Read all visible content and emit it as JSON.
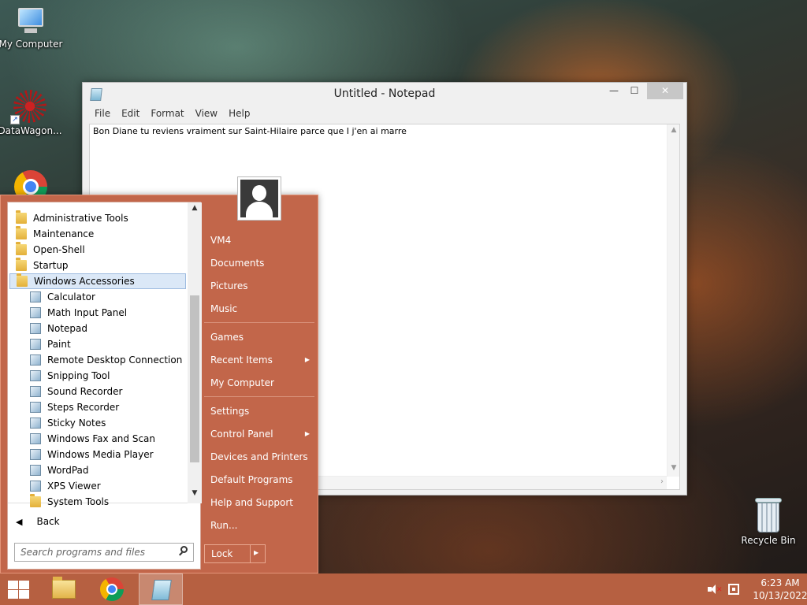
{
  "desktop": {
    "icons": [
      {
        "label": "My Computer"
      },
      {
        "label": "DataWagon..."
      },
      {
        "label": ""
      },
      {
        "label": "Recycle Bin"
      }
    ]
  },
  "notepad": {
    "title": "Untitled - Notepad",
    "controls": {
      "minimize": "—",
      "maximize": "☐",
      "close": "✕"
    },
    "menu": [
      "File",
      "Edit",
      "Format",
      "View",
      "Help"
    ],
    "content": "Bon Diane tu reviens vraiment sur Saint-Hilaire parce que I j'en ai marre"
  },
  "start_menu": {
    "programs": [
      {
        "label": "Administrative Tools",
        "icon": "folder-icon"
      },
      {
        "label": "Maintenance",
        "icon": "folder-icon"
      },
      {
        "label": "Open-Shell",
        "icon": "folder-icon"
      },
      {
        "label": "Startup",
        "icon": "folder-icon"
      },
      {
        "label": "Windows Accessories",
        "icon": "folder-icon",
        "selected": true
      },
      {
        "label": "Calculator",
        "icon": "calculator-icon"
      },
      {
        "label": "Math Input Panel",
        "icon": "math-input-icon"
      },
      {
        "label": "Notepad",
        "icon": "notepad-icon"
      },
      {
        "label": "Paint",
        "icon": "paint-icon"
      },
      {
        "label": "Remote Desktop Connection",
        "icon": "remote-desktop-icon"
      },
      {
        "label": "Snipping Tool",
        "icon": "snipping-tool-icon"
      },
      {
        "label": "Sound Recorder",
        "icon": "microphone-icon"
      },
      {
        "label": "Steps Recorder",
        "icon": "steps-recorder-icon"
      },
      {
        "label": "Sticky Notes",
        "icon": "sticky-notes-icon"
      },
      {
        "label": "Windows Fax and Scan",
        "icon": "fax-icon"
      },
      {
        "label": "Windows Media Player",
        "icon": "media-player-icon"
      },
      {
        "label": "WordPad",
        "icon": "wordpad-icon"
      },
      {
        "label": "XPS Viewer",
        "icon": "xps-viewer-icon"
      },
      {
        "label": "System Tools",
        "icon": "folder-icon"
      }
    ],
    "back_label": "Back",
    "search_placeholder": "Search programs and files",
    "right": {
      "items": [
        {
          "label": "VM4"
        },
        {
          "label": "Documents"
        },
        {
          "label": "Pictures"
        },
        {
          "label": "Music"
        },
        {
          "label": "Games"
        },
        {
          "label": "Recent Items",
          "submenu": true
        },
        {
          "label": "My Computer"
        },
        {
          "label": "Settings"
        },
        {
          "label": "Control Panel",
          "submenu": true
        },
        {
          "label": "Devices and Printers"
        },
        {
          "label": "Default Programs"
        },
        {
          "label": "Help and Support"
        },
        {
          "label": "Run..."
        }
      ],
      "lock_label": "Lock"
    }
  },
  "taskbar": {
    "clock_time": "6:23 AM",
    "clock_date": "10/13/2022",
    "accent_color": "#b66041"
  }
}
